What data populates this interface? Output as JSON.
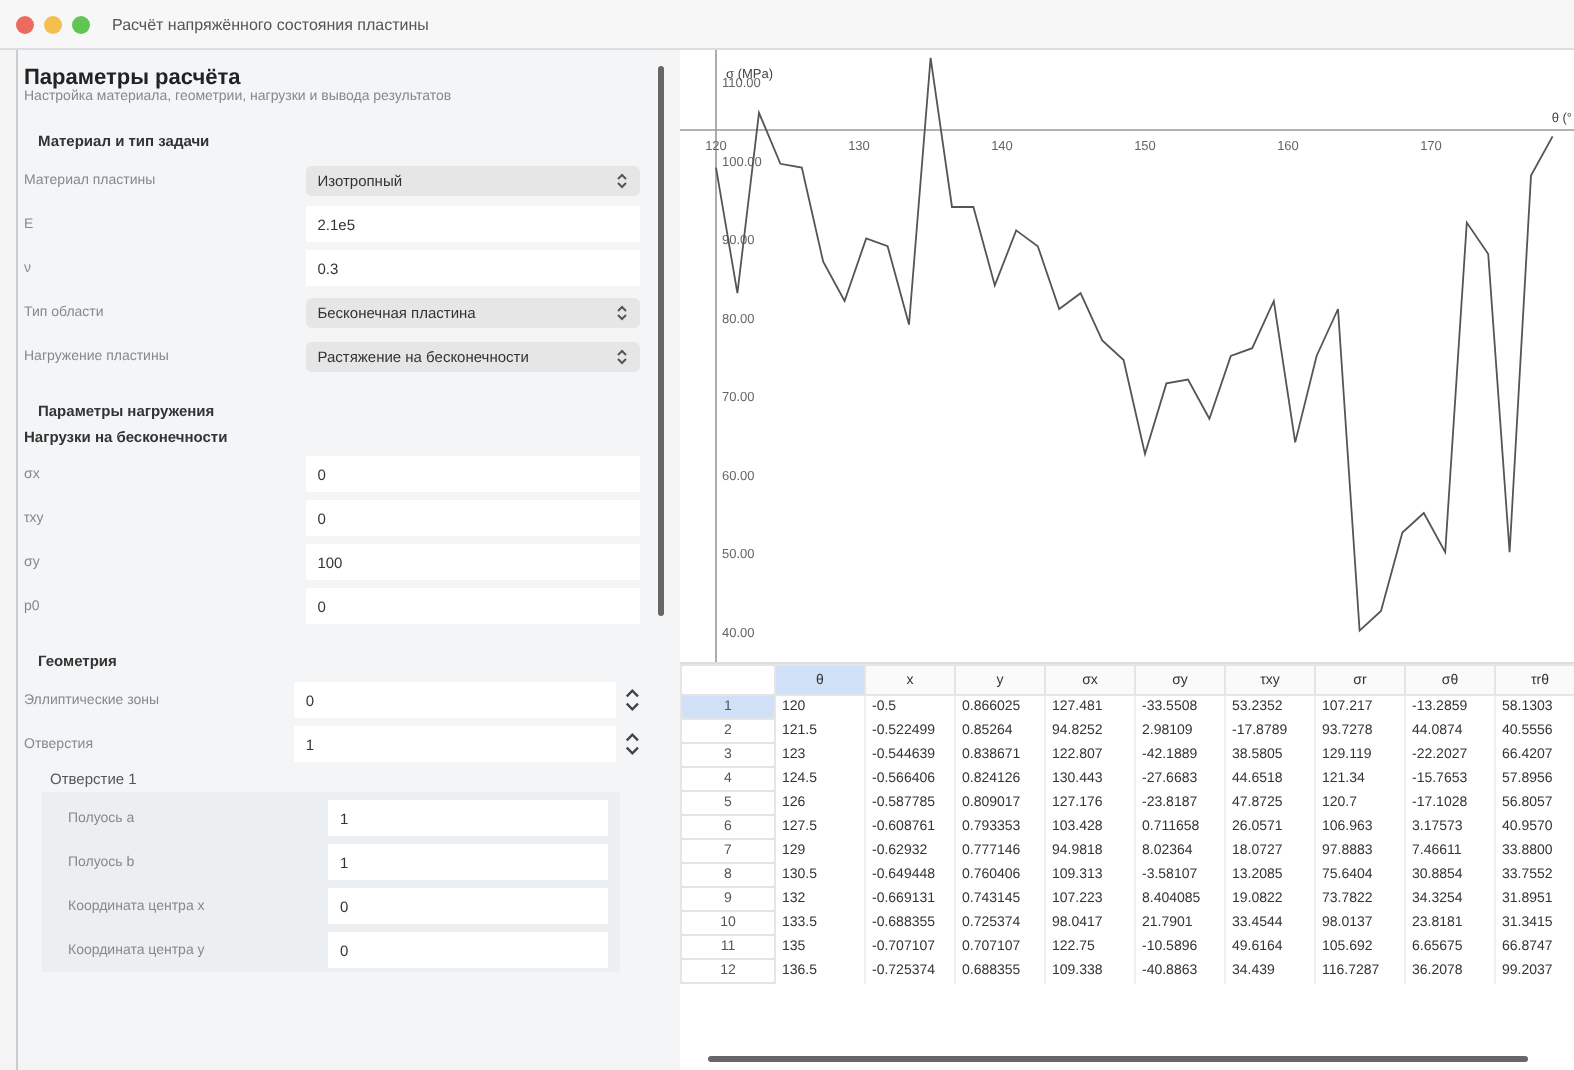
{
  "window": {
    "title": "Расчёт напряжённого состояния пластины"
  },
  "params": {
    "title": "Параметры расчёта",
    "subtitle": "Настройка материала, геометрии, нагрузки и вывода результатов",
    "sections": [
      {
        "title": "Материал и тип задачи",
        "fields": [
          {
            "kind": "select",
            "label": "Материал пластины",
            "value": "Изотропный"
          },
          {
            "kind": "input",
            "label": "E",
            "value": "2.1e5"
          },
          {
            "kind": "input",
            "label": "ν",
            "value": "0.3"
          },
          {
            "kind": "select",
            "label": "Тип области",
            "value": "Бесконечная пластина"
          },
          {
            "kind": "select",
            "label": "Нагружение пластины",
            "value": "Растяжение на бесконечности"
          }
        ]
      },
      {
        "title": "Параметры нагружения",
        "subtitle": "Нагрузки на бесконечности",
        "fields": [
          {
            "kind": "input",
            "label": "σx",
            "value": "0"
          },
          {
            "kind": "input",
            "label": "τxy",
            "value": "0"
          },
          {
            "kind": "input",
            "label": "σy",
            "value": "100"
          },
          {
            "kind": "input",
            "label": "p0",
            "value": "0"
          }
        ]
      },
      {
        "title": "Геометрия",
        "fields": [
          {
            "kind": "spin",
            "label": "Эллиптические зоны",
            "value": "0"
          },
          {
            "kind": "spin",
            "label": "Отверстия",
            "value": "1"
          }
        ],
        "groups": [
          {
            "title": "Отверстие 1",
            "fields": [
              {
                "kind": "input",
                "label": "Полуось a",
                "value": "1"
              },
              {
                "kind": "input",
                "label": "Полуось b",
                "value": "1"
              },
              {
                "kind": "input",
                "label": "Координата центра x",
                "value": "0"
              },
              {
                "kind": "input",
                "label": "Координата центра y",
                "value": "0"
              }
            ]
          }
        ]
      }
    ]
  },
  "chart": {
    "chart_data": {
      "type": "line",
      "xlabel": "θ (°",
      "ylabel": "σ (MPa)",
      "xlim": [
        120,
        180
      ],
      "ylim": [
        36,
        114
      ],
      "xticks": [
        120,
        130,
        140,
        150,
        160,
        170
      ],
      "yticks": [
        {
          "value": 40,
          "label": "40.00"
        },
        {
          "value": 50,
          "label": "50.00"
        },
        {
          "value": 60,
          "label": "60.00"
        },
        {
          "value": 70,
          "label": "70.00"
        },
        {
          "value": 80,
          "label": "80.00"
        },
        {
          "value": 90,
          "label": "90.00"
        },
        {
          "value": 100,
          "label": "100.00"
        },
        {
          "value": 110,
          "label": "110.00"
        }
      ],
      "x": [
        120,
        121.5,
        123,
        124.5,
        126,
        127.5,
        129,
        130.5,
        132,
        133.5,
        135,
        136.5,
        138,
        139.5,
        141,
        142.5,
        144,
        145.5,
        147,
        148.5,
        150,
        151.5,
        153,
        154.5,
        156,
        157.5,
        159,
        160.5,
        162,
        163.5,
        165,
        166.5,
        168,
        169.5,
        171,
        172.5,
        174,
        175.5,
        177,
        178.5
      ],
      "series": [
        {
          "color": "#555555",
          "values": [
            99,
            83,
            106,
            99.5,
            99,
            87,
            82,
            90,
            89,
            79,
            113,
            94,
            94,
            84,
            91,
            89,
            81,
            83,
            77,
            74.5,
            62.5,
            71.5,
            72,
            67,
            75,
            76,
            82,
            64,
            75,
            81,
            40,
            42.5,
            52.5,
            55,
            50,
            92,
            88,
            50,
            98,
            103
          ]
        }
      ]
    }
  },
  "table": {
    "columns": [
      {
        "label": "θ",
        "selected": true
      },
      {
        "label": "x",
        "selected": false
      },
      {
        "label": "y",
        "selected": false
      },
      {
        "label": "σx",
        "selected": false
      },
      {
        "label": "σy",
        "selected": false
      },
      {
        "label": "τxy",
        "selected": false
      },
      {
        "label": "σr",
        "selected": false
      },
      {
        "label": "σθ",
        "selected": false
      },
      {
        "label": "τrθ",
        "selected": false
      }
    ],
    "rows": [
      {
        "index": "1",
        "selected": true,
        "cells": [
          "120",
          "-0.5",
          "0.866025",
          "127.481",
          "-33.5508",
          "53.2352",
          "107.217",
          "-13.2859",
          "58.1303"
        ]
      },
      {
        "index": "2",
        "selected": false,
        "cells": [
          "121.5",
          "-0.522499",
          "0.85264",
          "94.8252",
          "2.98109",
          "-17.8789",
          "93.7278",
          "44.0874",
          "40.5556"
        ]
      },
      {
        "index": "3",
        "selected": false,
        "cells": [
          "123",
          "-0.544639",
          "0.838671",
          "122.807",
          "-42.1889",
          "38.5805",
          "129.119",
          "-22.2027",
          "66.4207"
        ]
      },
      {
        "index": "4",
        "selected": false,
        "cells": [
          "124.5",
          "-0.566406",
          "0.824126",
          "130.443",
          "-27.6683",
          "44.6518",
          "121.34",
          "-15.7653",
          "57.8956"
        ]
      },
      {
        "index": "5",
        "selected": false,
        "cells": [
          "126",
          "-0.587785",
          "0.809017",
          "127.176",
          "-23.8187",
          "47.8725",
          "120.7",
          "-17.1028",
          "56.8057"
        ]
      },
      {
        "index": "6",
        "selected": false,
        "cells": [
          "127.5",
          "-0.608761",
          "0.793353",
          "103.428",
          "0.711658",
          "26.0571",
          "106.963",
          "3.17573",
          "40.9570"
        ]
      },
      {
        "index": "7",
        "selected": false,
        "cells": [
          "129",
          "-0.62932",
          "0.777146",
          "94.9818",
          "8.02364",
          "18.0727",
          "97.8883",
          "7.46611",
          "33.8800"
        ]
      },
      {
        "index": "8",
        "selected": false,
        "cells": [
          "130.5",
          "-0.649448",
          "0.760406",
          "109.313",
          "-3.58107",
          "13.2085",
          "75.6404",
          "30.8854",
          "33.7552"
        ]
      },
      {
        "index": "9",
        "selected": false,
        "cells": [
          "132",
          "-0.669131",
          "0.743145",
          "107.223",
          "8.404085",
          "19.0822",
          "73.7822",
          "34.3254",
          "31.8951"
        ]
      },
      {
        "index": "10",
        "selected": false,
        "cells": [
          "133.5",
          "-0.688355",
          "0.725374",
          "98.0417",
          "21.7901",
          "33.4544",
          "98.0137",
          "23.8181",
          "31.3415"
        ]
      },
      {
        "index": "11",
        "selected": false,
        "cells": [
          "135",
          "-0.707107",
          "0.707107",
          "122.75",
          "-10.5896",
          "49.6164",
          "105.692",
          "6.65675",
          "66.8747"
        ]
      },
      {
        "index": "12",
        "selected": false,
        "cells": [
          "136.5",
          "-0.725374",
          "0.688355",
          "109.338",
          "-40.8863",
          "34.439",
          "116.7287",
          "36.2078",
          "99.2037"
        ]
      }
    ]
  }
}
